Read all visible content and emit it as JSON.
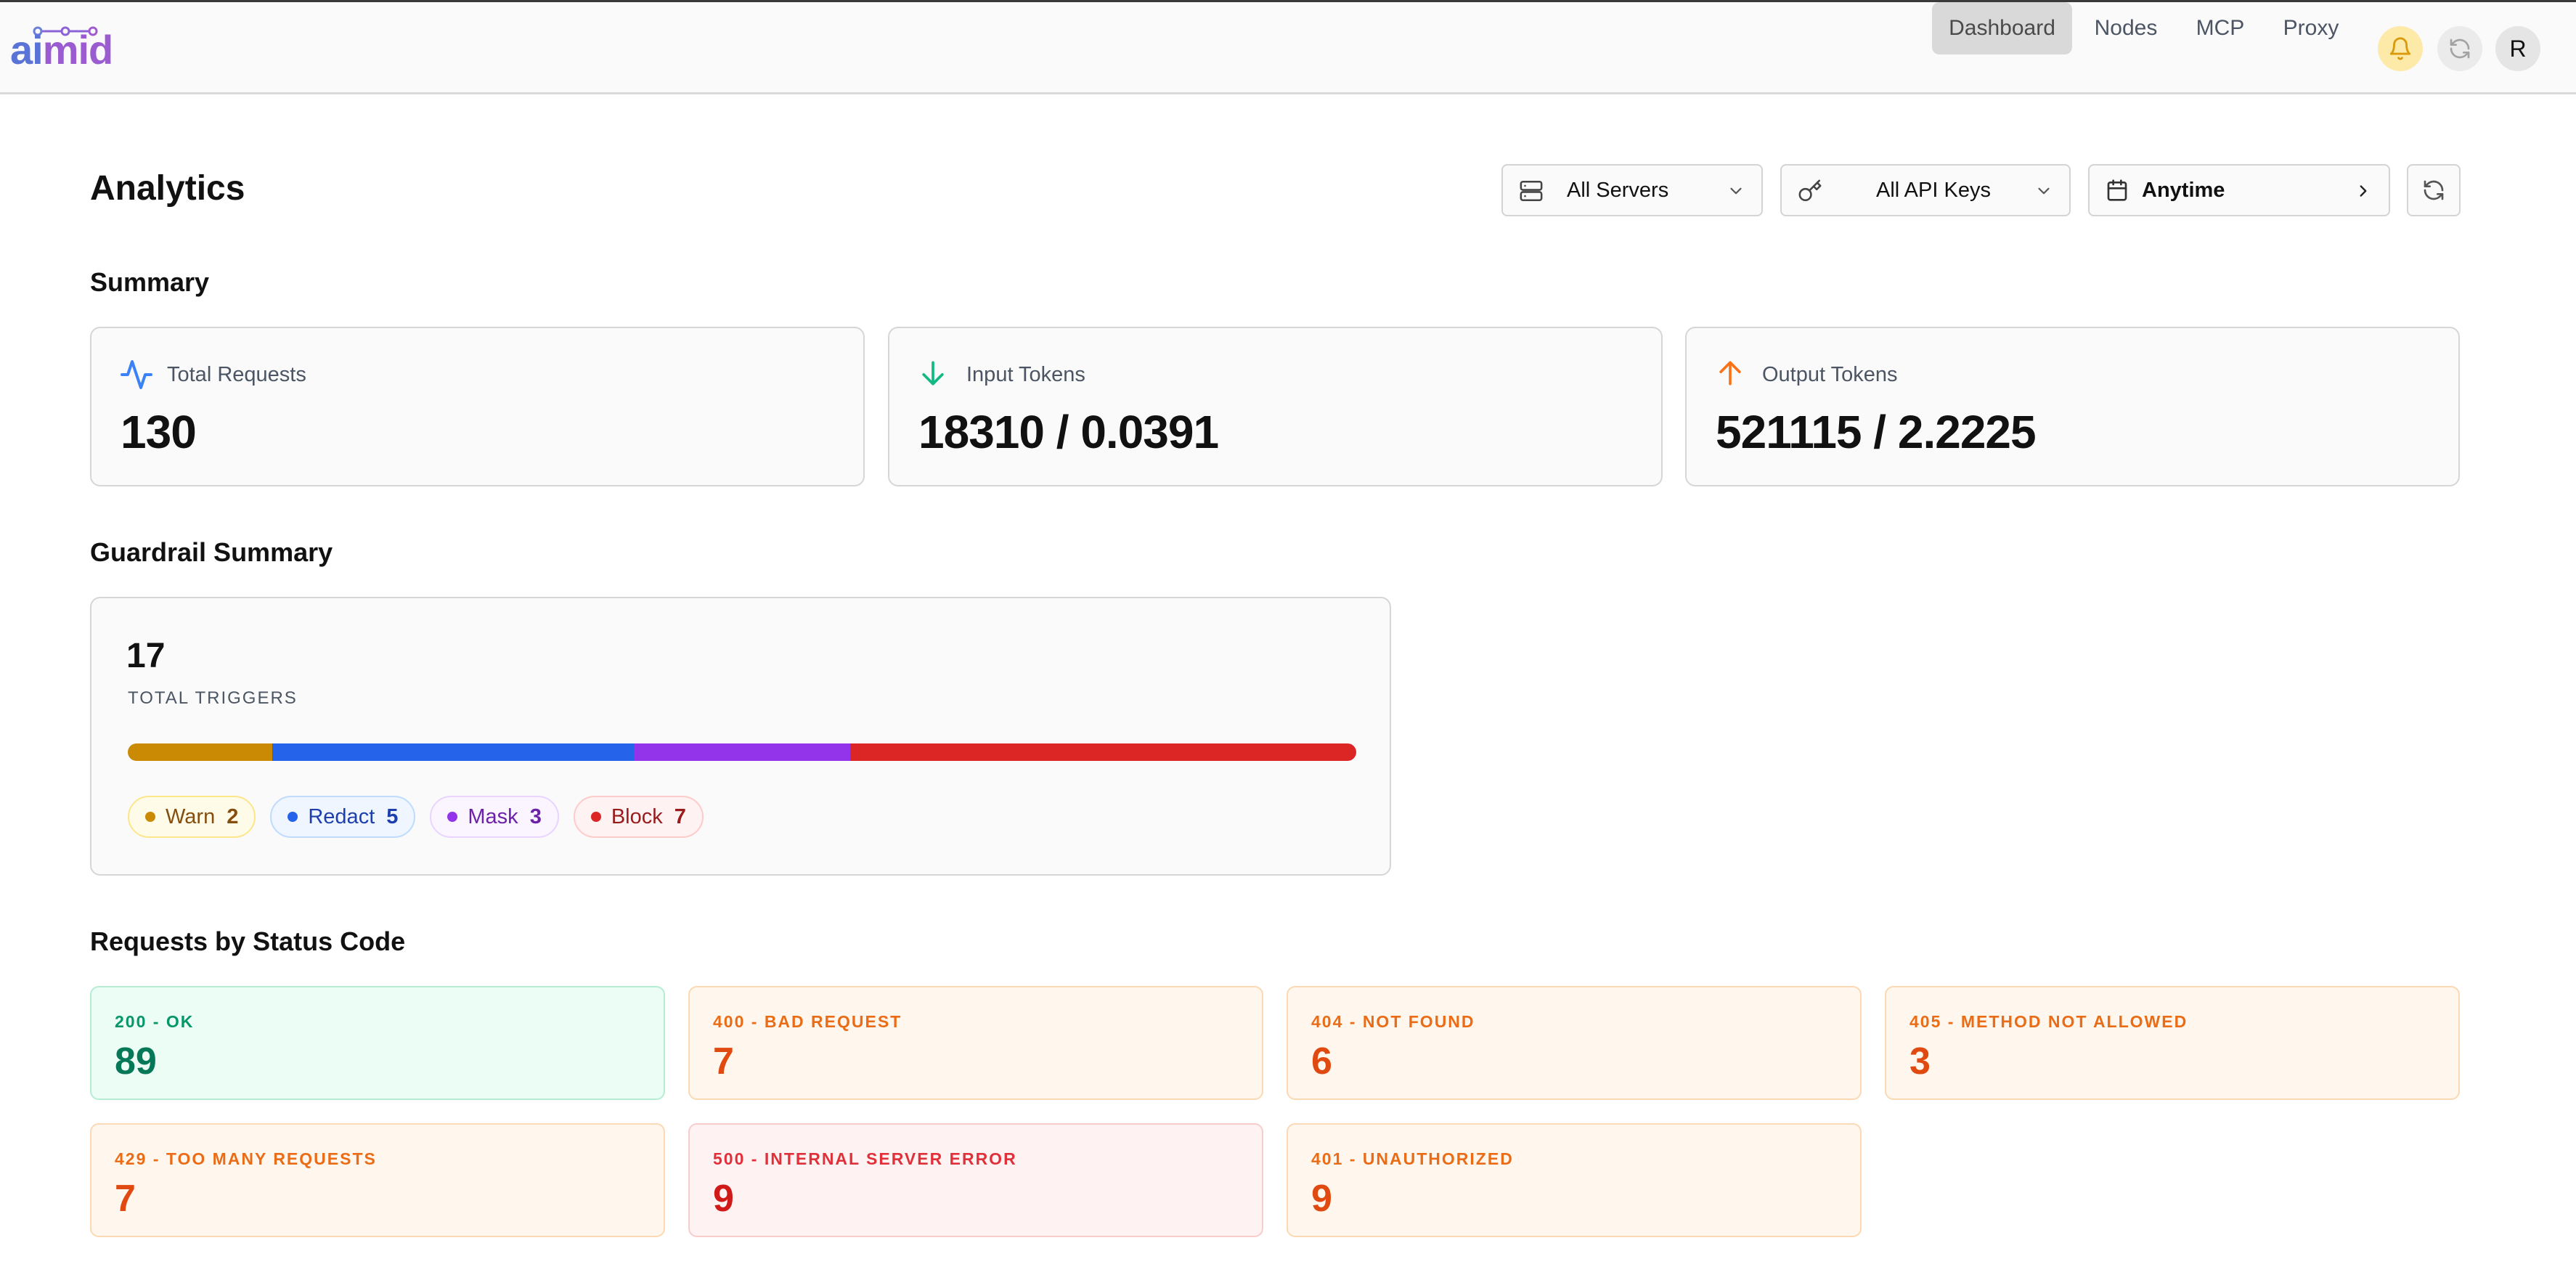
{
  "app": {
    "logo_text": "aimid"
  },
  "nav": {
    "items": [
      {
        "label": "Dashboard",
        "active": true
      },
      {
        "label": "Nodes",
        "active": false
      },
      {
        "label": "MCP",
        "active": false
      },
      {
        "label": "Proxy",
        "active": false
      }
    ],
    "avatar_initial": "R"
  },
  "page": {
    "title": "Analytics"
  },
  "filters": {
    "servers": "All Servers",
    "api_keys": "All API Keys",
    "time_range": "Anytime"
  },
  "summary": {
    "title": "Summary",
    "cards": [
      {
        "label": "Total Requests",
        "value": "130",
        "icon": "activity-icon",
        "color": "#3b82f6"
      },
      {
        "label": "Input Tokens",
        "value": "18310 / 0.0391",
        "icon": "arrow-down-icon",
        "color": "#10b981"
      },
      {
        "label": "Output Tokens",
        "value": "521115 / 2.2225",
        "icon": "arrow-up-icon",
        "color": "#f97316"
      }
    ]
  },
  "guardrail": {
    "title": "Guardrail Summary",
    "total": "17",
    "total_label": "TOTAL TRIGGERS",
    "items": [
      {
        "label": "Warn",
        "count": 2,
        "color": "#ca8a04",
        "bg": "#fefce8",
        "border": "#fde68a",
        "text": "#854d0e"
      },
      {
        "label": "Redact",
        "count": 5,
        "color": "#2563eb",
        "bg": "#eff6ff",
        "border": "#bfdbfe",
        "text": "#1e40af"
      },
      {
        "label": "Mask",
        "count": 3,
        "color": "#9333ea",
        "bg": "#faf5ff",
        "border": "#e9d5ff",
        "text": "#6b21a8"
      },
      {
        "label": "Block",
        "count": 7,
        "color": "#dc2626",
        "bg": "#fef2f2",
        "border": "#fecaca",
        "text": "#991b1b"
      }
    ]
  },
  "status_codes": {
    "title": "Requests by Status Code",
    "items": [
      {
        "label": "200 - OK",
        "value": "89",
        "kind": "ok"
      },
      {
        "label": "400 - BAD REQUEST",
        "value": "7",
        "kind": "warn"
      },
      {
        "label": "404 - NOT FOUND",
        "value": "6",
        "kind": "warn"
      },
      {
        "label": "405 - METHOD NOT ALLOWED",
        "value": "3",
        "kind": "warn"
      },
      {
        "label": "429 - TOO MANY REQUESTS",
        "value": "7",
        "kind": "warn"
      },
      {
        "label": "500 - INTERNAL SERVER ERROR",
        "value": "9",
        "kind": "err"
      },
      {
        "label": "401 - UNAUTHORIZED",
        "value": "9",
        "kind": "warn"
      }
    ]
  }
}
